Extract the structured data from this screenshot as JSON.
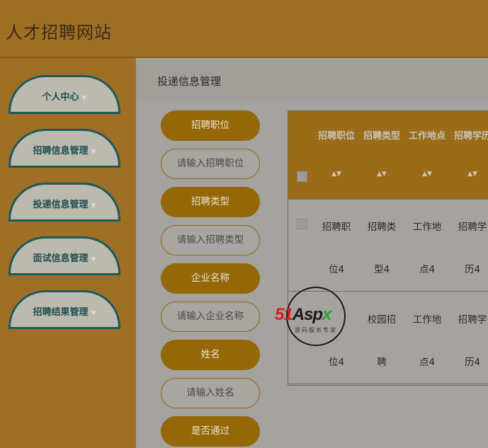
{
  "header": {
    "site_title": "人才招聘网站"
  },
  "sidebar": {
    "items": [
      {
        "label": "个人中心"
      },
      {
        "label": "招聘信息管理"
      },
      {
        "label": "投递信息管理"
      },
      {
        "label": "面试信息管理"
      },
      {
        "label": "招聘结果管理"
      }
    ],
    "caret": "▼"
  },
  "main": {
    "title": "投递信息管理",
    "filters": [
      {
        "label": "招聘职位",
        "placeholder": "请输入招聘职位"
      },
      {
        "label": "招聘类型",
        "placeholder": "请输入招聘类型"
      },
      {
        "label": "企业名称",
        "placeholder": "请输入企业名称"
      },
      {
        "label": "姓名",
        "placeholder": "请输入姓名"
      },
      {
        "label": "是否通过"
      }
    ]
  },
  "table": {
    "columns": [
      "招聘职位",
      "招聘类型",
      "工作地点",
      "招聘学历"
    ],
    "sort_icon": "▲▼",
    "rows": [
      {
        "line1": [
          "招聘职",
          "招聘类",
          "工作地",
          "招聘学"
        ],
        "line2": [
          "位4",
          "型4",
          "点4",
          "历4"
        ]
      },
      {
        "line1": [
          "",
          "校园招",
          "工作地",
          "招聘学"
        ],
        "line2": [
          "位4",
          "聘",
          "点4",
          "历4"
        ]
      }
    ]
  },
  "watermark": {
    "logo_a": "51",
    "logo_b": "Asp",
    "logo_c": "x",
    "subtitle": "源码服务专家"
  }
}
